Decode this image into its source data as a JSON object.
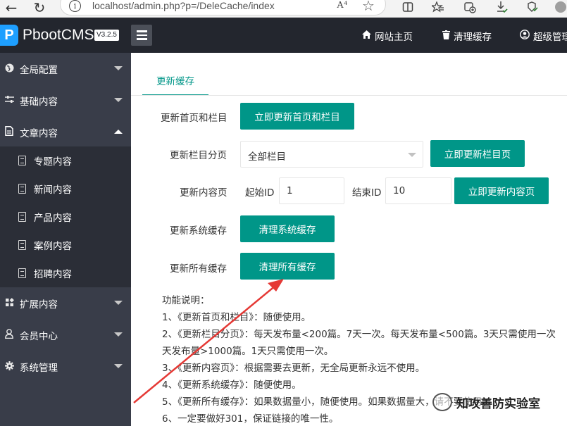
{
  "browser": {
    "url": "localhost/admin.php?p=/DeleCache/index",
    "read_aloud_label": "A⁴"
  },
  "header": {
    "logo_mark": "P",
    "logo_text": "PbootCMS",
    "version": "V3.2.5",
    "links": [
      {
        "icon": "home-icon",
        "label": "网站主页"
      },
      {
        "icon": "trash-icon",
        "label": "清理缓存"
      },
      {
        "icon": "user-icon",
        "label": "超级管理"
      }
    ]
  },
  "sidebar": {
    "items": [
      {
        "icon": "globe-icon",
        "label": "全局配置",
        "expanded": false
      },
      {
        "icon": "sliders-icon",
        "label": "基础内容",
        "expanded": false
      },
      {
        "icon": "file-icon",
        "label": "文章内容",
        "expanded": true
      },
      {
        "icon": "puzzle-icon",
        "label": "扩展内容",
        "expanded": false
      },
      {
        "icon": "person-icon",
        "label": "会员中心",
        "expanded": false
      },
      {
        "icon": "gear-icon",
        "label": "系统管理",
        "expanded": false
      }
    ],
    "sub_items": [
      {
        "label": "专题内容"
      },
      {
        "label": "新闻内容"
      },
      {
        "label": "产品内容"
      },
      {
        "label": "案例内容"
      },
      {
        "label": "招聘内容"
      }
    ]
  },
  "main": {
    "tab_label": "更新缓存",
    "rows": {
      "home_label": "更新首页和栏目",
      "home_button": "立即更新首页和栏目",
      "column_label": "更新栏目分页",
      "column_select": "全部栏目",
      "column_button": "立即更新栏目页",
      "content_label": "更新内容页",
      "start_id_label": "起始ID",
      "start_id_value": "1",
      "end_id_label": "结束ID",
      "end_id_value": "10",
      "content_button": "立即更新内容页",
      "system_label": "更新系统缓存",
      "system_button": "清理系统缓存",
      "all_label": "更新所有缓存",
      "all_button": "清理所有缓存"
    },
    "notes": [
      "功能说明：",
      "1、《更新首页和栏目》：随便使用。",
      "2、《更新栏目分页》：每天发布量<200篇。7天一次。每天发布量<500篇。3天只需使用一次",
      "天发布量>1000篇。1天只需使用一次。",
      "3、《更新内容页》：根据需要去更新，无全局更新永远不使用。",
      "4、《更新系统缓存》：随便使用。",
      "5、《更新所有缓存》：如果数据量小，随便使用。如果数据量大，请不要使用。",
      "6、一定要做好301，保证链接的唯一性。"
    ]
  },
  "watermark": {
    "text": "知攻善防实验室"
  },
  "colors": {
    "accent": "#009688",
    "sidebar_bg": "#393d49",
    "header_bg": "#23262e",
    "annotation_arrow": "#e53935"
  }
}
